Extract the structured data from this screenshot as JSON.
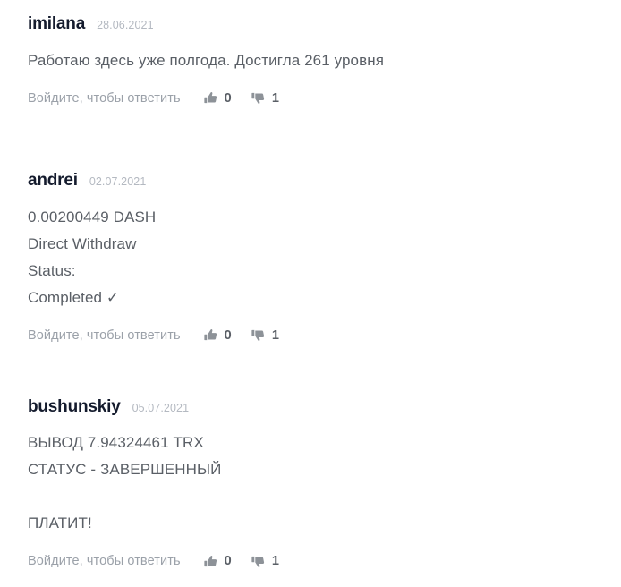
{
  "page": {
    "background": "#ffffff",
    "text_color": "#5a5f66",
    "author_color": "#141b2d",
    "date_color": "#b4b9c1",
    "muted_color": "#9ba1a9",
    "icon_color": "#8d9298"
  },
  "comments": [
    {
      "author": "imilana",
      "date": "28.06.2021",
      "lines": [
        "Работаю здесь уже полгода. Достигла 261 уровня"
      ],
      "reply_label": "Войдите, чтобы ответить",
      "likes": "0",
      "dislikes": "1",
      "like_icon": "thumbs-up-icon",
      "dislike_icon": "thumbs-down-icon"
    },
    {
      "author": "andrei",
      "date": "02.07.2021",
      "lines": [
        "0.00200449 DASH",
        "Direct Withdraw",
        "Status:",
        "Completed ✓"
      ],
      "reply_label": "Войдите, чтобы ответить",
      "likes": "0",
      "dislikes": "1",
      "like_icon": "thumbs-up-icon",
      "dislike_icon": "thumbs-down-icon"
    },
    {
      "author": "bushunskiy",
      "date": "05.07.2021",
      "lines": [
        "ВЫВОД 7.94324461 TRX",
        "СТАТУС - ЗАВЕРШЕННЫЙ",
        "",
        "ПЛАТИТ!"
      ],
      "reply_label": "Войдите, чтобы ответить",
      "likes": "0",
      "dislikes": "1",
      "like_icon": "thumbs-up-icon",
      "dislike_icon": "thumbs-down-icon"
    }
  ]
}
